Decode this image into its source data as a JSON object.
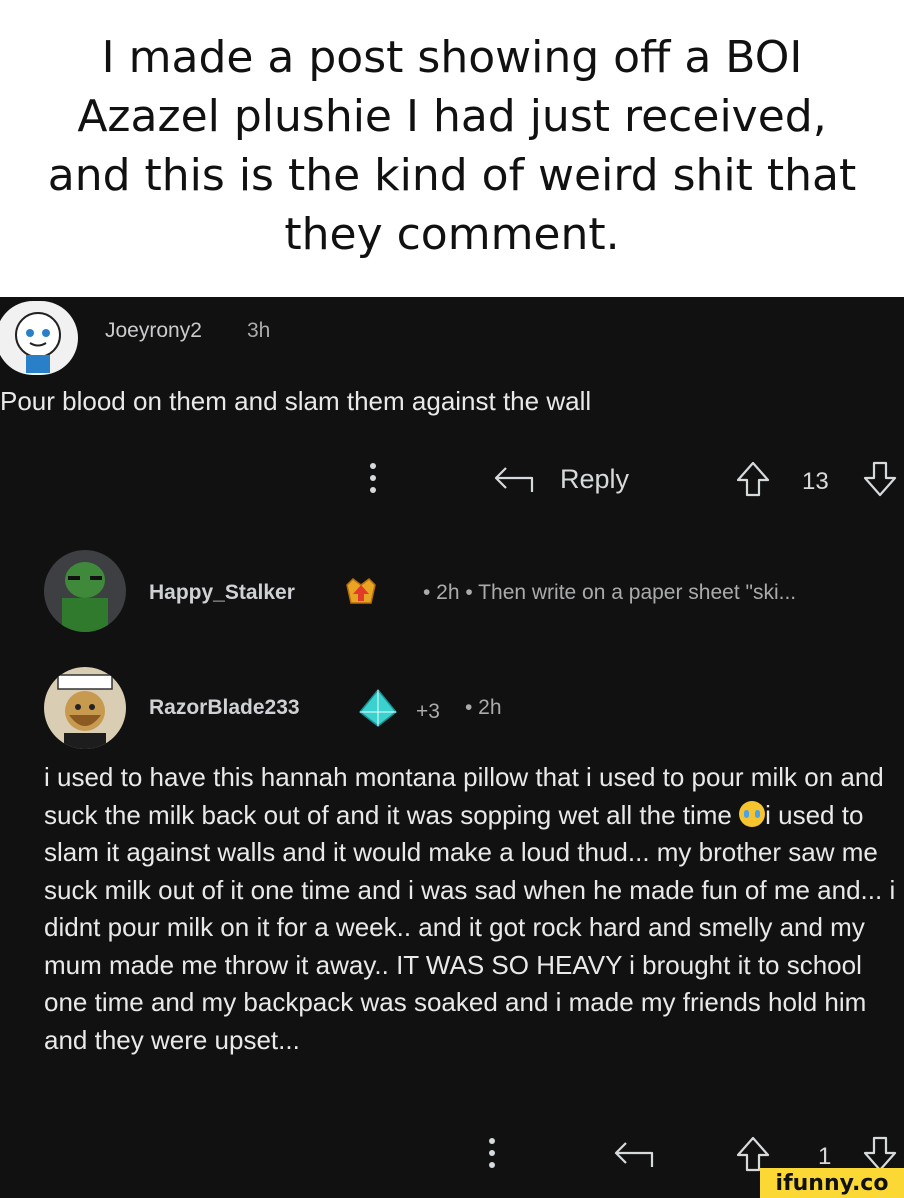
{
  "caption": {
    "text": "I made a post showing off a BOI Azazel plushie I had just received, and this is the kind of weird shit that they comment."
  },
  "comment1": {
    "username": "Joeyrony2",
    "time": "3h",
    "body": "Pour blood on them and slam them against the wall",
    "reply_label": "Reply",
    "vote_count": "13"
  },
  "comment2": {
    "username": "Happy_Stalker",
    "meta": "• 2h • Then write on a paper sheet \"ski..."
  },
  "comment3": {
    "username": "RazorBlade233",
    "award_count": "+3",
    "time": "• 2h",
    "body_before_emoji": "i used to have this hannah montana pillow that i used to pour milk on and suck the milk back out of and it was sopping wet all the time ",
    "body_after_emoji": "i used to slam it against walls and it would make a loud thud... my brother saw me suck milk out of it one time and i was sad when he made fun of me and... i didnt pour milk on it for a week..  and it got rock hard and smelly and my mum made me throw it away.. IT WAS SO HEAVY i brought it to school one time and my backpack was soaked and i made my friends hold him and they were upset...",
    "vote_count": "1"
  },
  "watermark": "ifunny.co",
  "colors": {
    "background": "#111111",
    "text": "#d7dadc",
    "watermark": "#fbd833"
  }
}
